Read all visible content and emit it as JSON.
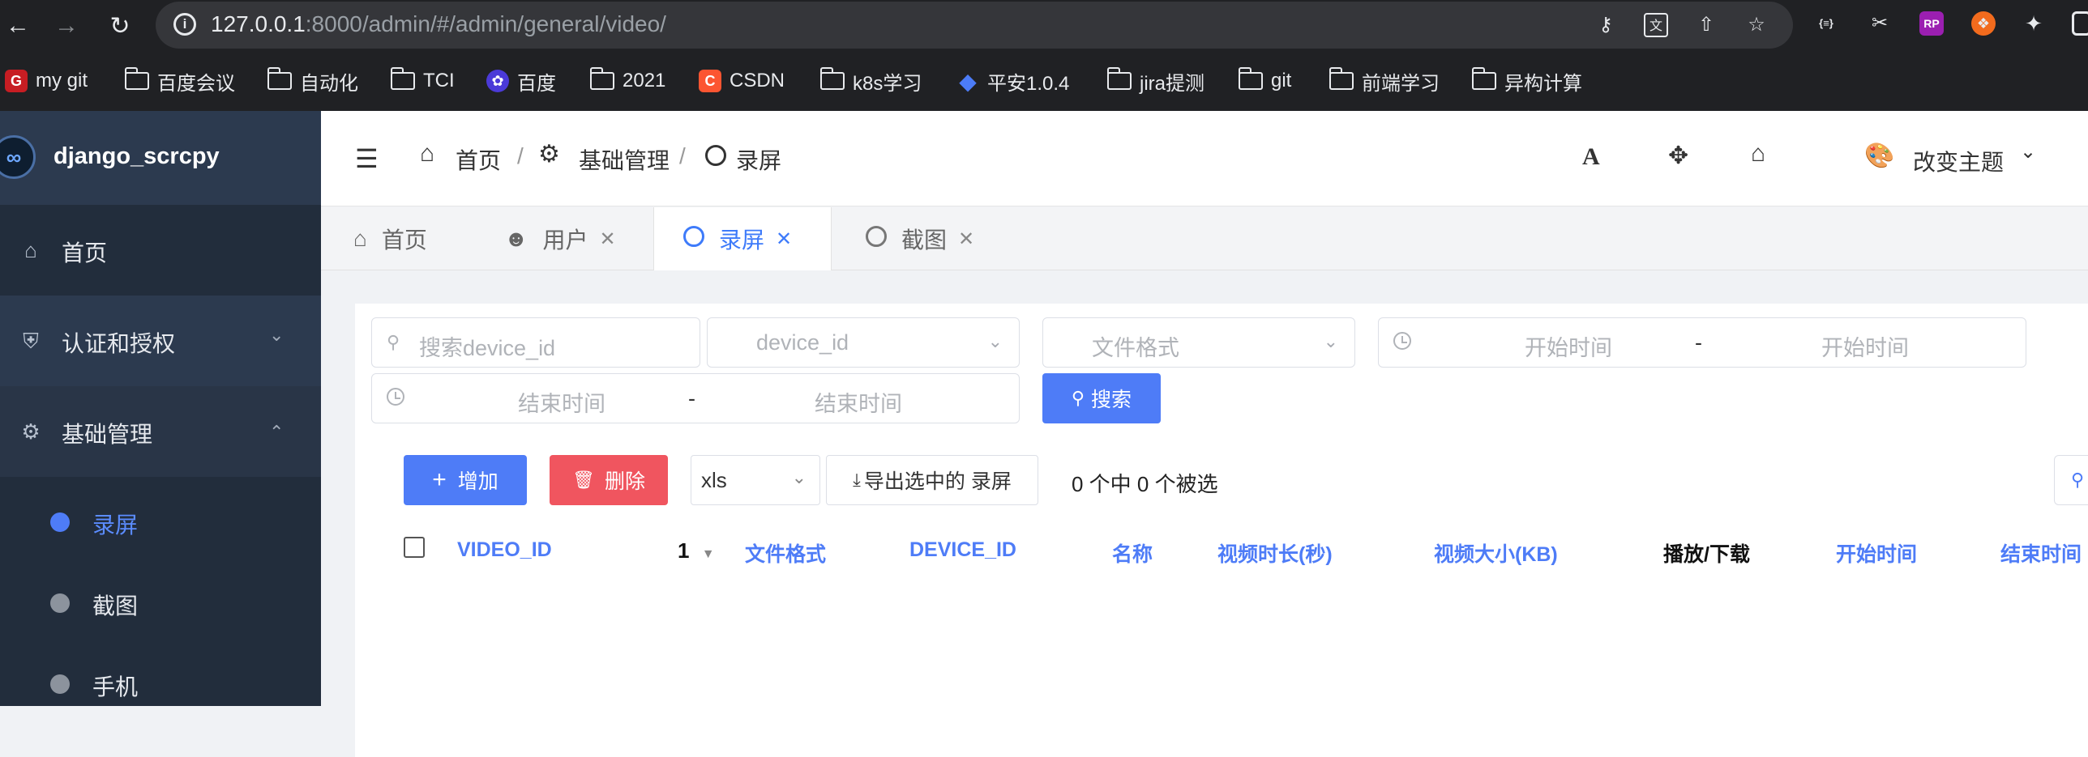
{
  "browser": {
    "url_host": "127.0.0.1",
    "url_rest": ":8000/admin/#/admin/general/video/",
    "bookmarks": [
      {
        "label": "my git",
        "icon": "gitee"
      },
      {
        "label": "百度会议",
        "icon": "folder"
      },
      {
        "label": "自动化",
        "icon": "folder"
      },
      {
        "label": "TCI",
        "icon": "folder"
      },
      {
        "label": "百度",
        "icon": "baidu"
      },
      {
        "label": "2021",
        "icon": "folder"
      },
      {
        "label": "CSDN",
        "icon": "csdn"
      },
      {
        "label": "k8s学习",
        "icon": "folder"
      },
      {
        "label": "平安1.0.4",
        "icon": "jira"
      },
      {
        "label": "jira提测",
        "icon": "folder"
      },
      {
        "label": "git",
        "icon": "folder"
      },
      {
        "label": "前端学习",
        "icon": "folder"
      },
      {
        "label": "异构计算",
        "icon": "folder"
      }
    ],
    "ext_badge": "RP",
    "ext_code": "{≡}"
  },
  "sidebar": {
    "brand": "django_scrcpy",
    "items": [
      {
        "label": "首页"
      },
      {
        "label": "认证和授权"
      },
      {
        "label": "基础管理"
      }
    ],
    "subitems": [
      {
        "label": "录屏",
        "active": true
      },
      {
        "label": "截图",
        "active": false
      },
      {
        "label": "手机",
        "active": false
      }
    ]
  },
  "header": {
    "breadcrumb": [
      "首页",
      "基础管理",
      "录屏"
    ],
    "separator": "/",
    "theme_label": "改变主题",
    "font_icon_text": "A"
  },
  "tabs": [
    {
      "label": "首页",
      "closable": false
    },
    {
      "label": "用户",
      "closable": true
    },
    {
      "label": "录屏",
      "closable": true,
      "active": true
    },
    {
      "label": "截图",
      "closable": true
    }
  ],
  "filters": {
    "search_placeholder": "搜索device_id",
    "device_placeholder": "device_id",
    "format_placeholder": "文件格式",
    "start_from": "开始时间",
    "start_to": "开始时间",
    "end_from": "结束时间",
    "end_to": "结束时间",
    "range_sep": "-",
    "search_button": "搜索"
  },
  "actions": {
    "add": "增加",
    "delete": "删除",
    "export_format": "xls",
    "export": "导出选中的 录屏",
    "selection_status": "0 个中 0 个被选"
  },
  "table": {
    "columns": [
      "VIDEO_ID",
      "文件格式",
      "DEVICE_ID",
      "名称",
      "视频时长(秒)",
      "视频大小(KB)",
      "播放/下载",
      "开始时间",
      "结束时间"
    ],
    "sort_index": "1"
  }
}
